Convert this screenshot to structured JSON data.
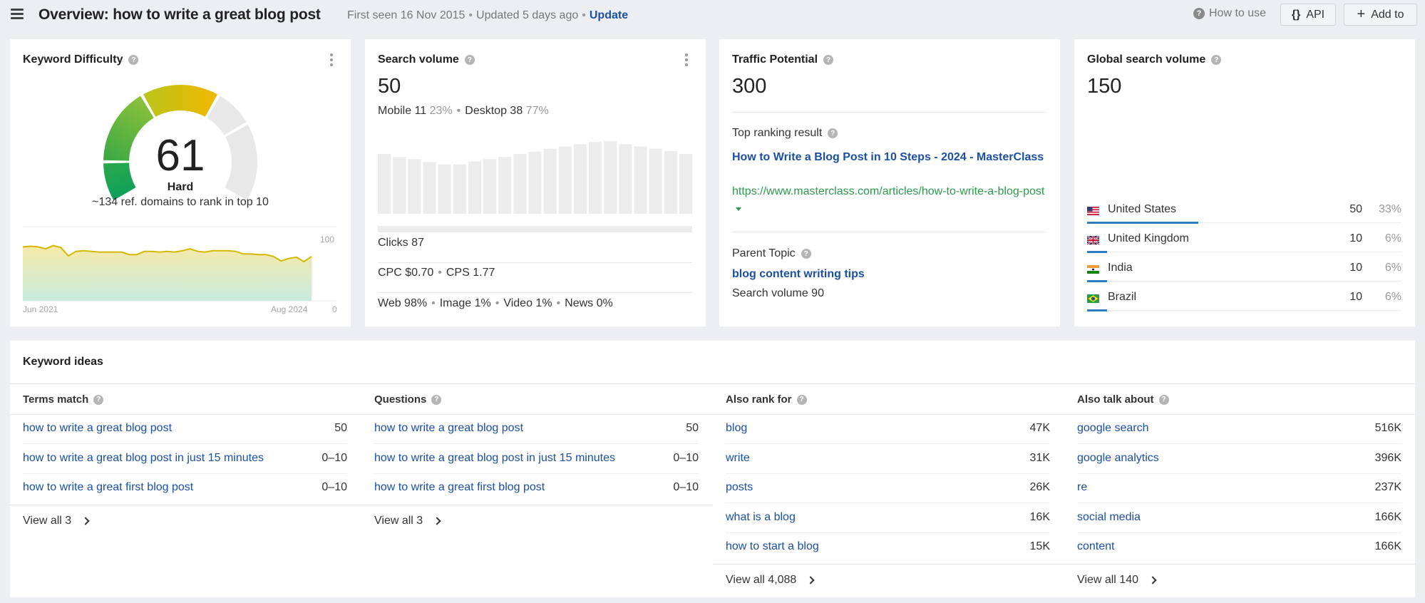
{
  "header": {
    "title": "Overview: how to write a great blog post",
    "first_seen": "First seen 16 Nov 2015",
    "updated": "Updated 5 days ago",
    "update_link": "Update",
    "how_to_use": "How to use",
    "api_label": "API",
    "add_to_label": "Add to"
  },
  "keyword_difficulty": {
    "title": "Keyword Difficulty",
    "value": "61",
    "score": 61,
    "label": "Hard",
    "subtitle": "~134 ref. domains to rank in top 10",
    "gauge_colors": [
      "#0a9e5a",
      "#5cb335",
      "#d4c20a",
      "#f0b800",
      "#e6e6e6"
    ],
    "chart": {
      "x_start": "Jun 2021",
      "x_end": "Aug 2024",
      "y_max_label": "100",
      "y_min_label": "0",
      "y_range": [
        0,
        100
      ],
      "values": [
        84,
        85,
        84,
        81,
        86,
        83,
        70,
        77,
        78,
        77,
        76,
        76,
        76,
        76,
        72,
        72,
        77,
        77,
        76,
        77,
        76,
        78,
        81,
        77,
        76,
        78,
        78,
        78,
        77,
        73,
        73,
        72,
        72,
        69,
        62,
        66,
        68,
        61,
        69
      ]
    }
  },
  "search_volume": {
    "title": "Search volume",
    "value": "50",
    "mobile_label": "Mobile 11",
    "mobile_pct": "23%",
    "desktop_label": "Desktop 38",
    "desktop_pct": "77%",
    "trend_bars": [
      80,
      76,
      73,
      69,
      66,
      66,
      70,
      73,
      76,
      80,
      83,
      87,
      90,
      93,
      96,
      97,
      93,
      90,
      87,
      84,
      80
    ],
    "clicks": "Clicks 87",
    "cpc": "CPC $0.70",
    "cps": "CPS 1.77",
    "serp_types": [
      "Web 98%",
      "Image 1%",
      "Video 1%",
      "News 0%"
    ]
  },
  "traffic_potential": {
    "title": "Traffic Potential",
    "value": "300",
    "top_result_label": "Top ranking result",
    "top_result_title": "How to Write a Blog Post in 10 Steps - 2024 - MasterClass",
    "top_result_url": "https://www.masterclass.com/articles/how-to-write-a-blog-post",
    "parent_topic_label": "Parent Topic",
    "parent_topic": "blog content writing tips",
    "parent_volume": "Search volume 90"
  },
  "global_volume": {
    "title": "Global search volume",
    "value": "150",
    "countries": [
      {
        "name": "United States",
        "volume": "50",
        "pct": "33%",
        "share": 0.33,
        "flag": "us"
      },
      {
        "name": "United Kingdom",
        "volume": "10",
        "pct": "6%",
        "share": 0.06,
        "flag": "gb"
      },
      {
        "name": "India",
        "volume": "10",
        "pct": "6%",
        "share": 0.06,
        "flag": "in"
      },
      {
        "name": "Brazil",
        "volume": "10",
        "pct": "6%",
        "share": 0.06,
        "flag": "br"
      }
    ]
  },
  "keyword_ideas": {
    "title": "Keyword ideas",
    "columns": [
      {
        "heading": "Terms match",
        "rows": [
          {
            "keyword": "how to write a great blog post",
            "volume": "50"
          },
          {
            "keyword": "how to write a great blog post in just 15 minutes",
            "volume": "0–10"
          },
          {
            "keyword": "how to write a great first blog post",
            "volume": "0–10"
          }
        ],
        "view_all": "View all 3"
      },
      {
        "heading": "Questions",
        "rows": [
          {
            "keyword": "how to write a great blog post",
            "volume": "50"
          },
          {
            "keyword": "how to write a great blog post in just 15 minutes",
            "volume": "0–10"
          },
          {
            "keyword": "how to write a great first blog post",
            "volume": "0–10"
          }
        ],
        "view_all": "View all 3"
      },
      {
        "heading": "Also rank for",
        "rows": [
          {
            "keyword": "blog",
            "volume": "47K"
          },
          {
            "keyword": "write",
            "volume": "31K"
          },
          {
            "keyword": "posts",
            "volume": "26K"
          },
          {
            "keyword": "what is a blog",
            "volume": "16K"
          },
          {
            "keyword": "how to start a blog",
            "volume": "15K"
          }
        ],
        "view_all": "View all 4,088"
      },
      {
        "heading": "Also talk about",
        "rows": [
          {
            "keyword": "google search",
            "volume": "516K"
          },
          {
            "keyword": "google analytics",
            "volume": "396K"
          },
          {
            "keyword": "re",
            "volume": "237K"
          },
          {
            "keyword": "social media",
            "volume": "166K"
          },
          {
            "keyword": "content",
            "volume": "166K"
          }
        ],
        "view_all": "View all 140"
      }
    ]
  },
  "colors": {
    "link": "#1b4fa8",
    "url_green": "#2e9a4e",
    "bar_blue": "#2f7dc1",
    "kd_line": "#d4b800"
  }
}
